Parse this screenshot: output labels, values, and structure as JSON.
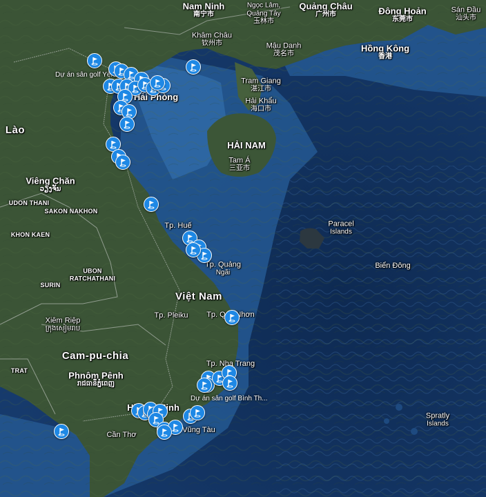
{
  "map": {
    "colors": {
      "sea_deep": "#112f5a",
      "sea_shelf": "#1e4a86",
      "land": "#3d5a3a",
      "island": "#2f3a3a"
    },
    "labels": [
      {
        "key": "nanning",
        "text": "Nam Ninh",
        "sub": "南宁市",
        "cls": "region"
      },
      {
        "key": "ngoclam",
        "text": "Ngọc Lâm,",
        "sub": "Quảng Tây",
        "cls": "small2"
      },
      {
        "key": "ngoclam2",
        "text": "",
        "sub": "玉林市",
        "cls": ""
      },
      {
        "key": "guangzhou",
        "text": "Quảng Châu",
        "sub": "广州市",
        "cls": "region"
      },
      {
        "key": "dongguan",
        "text": "Đông Hoản",
        "sub": "东莞市",
        "cls": "region"
      },
      {
        "key": "shantou",
        "text": "Sán Đầu",
        "sub": "汕头市",
        "cls": ""
      },
      {
        "key": "khamchau",
        "text": "Khâm Châu",
        "sub": "钦州市",
        "cls": ""
      },
      {
        "key": "maudanh",
        "text": "Mậu Danh",
        "sub": "茂名市",
        "cls": ""
      },
      {
        "key": "hongkong",
        "text": "Hồng Kông",
        "sub": "香港",
        "cls": "region"
      },
      {
        "key": "tramgiang",
        "text": "Tram Giang",
        "sub": "湛江市",
        "cls": ""
      },
      {
        "key": "haikhau",
        "text": "Hải Khẩu",
        "sub": "海口市",
        "cls": ""
      },
      {
        "key": "hainam",
        "text": "HẢI NAM",
        "sub": "",
        "cls": "region"
      },
      {
        "key": "tama",
        "text": "Tam Á",
        "sub": "三亚市",
        "cls": ""
      },
      {
        "key": "lao",
        "text": "Lào",
        "sub": "",
        "cls": "country"
      },
      {
        "key": "vientiane",
        "text": "Viêng Chăn",
        "sub": "ວຽງຈັນ",
        "cls": "region"
      },
      {
        "key": "udon",
        "text": "UDON THANI",
        "sub": "",
        "cls": "small"
      },
      {
        "key": "sakon",
        "text": "SAKON NAKHON",
        "sub": "",
        "cls": "small"
      },
      {
        "key": "khonkaen",
        "text": "KHON KAEN",
        "sub": "",
        "cls": "small"
      },
      {
        "key": "ubon",
        "text": "UBON",
        "sub": "RATCHATHANI",
        "cls": "small"
      },
      {
        "key": "surin",
        "text": "SURIN",
        "sub": "",
        "cls": "small"
      },
      {
        "key": "hue",
        "text": "Tp. Huế",
        "sub": "",
        "cls": ""
      },
      {
        "key": "quangngai",
        "text": "Tp. Quảng",
        "sub": "Ngãi",
        "cls": ""
      },
      {
        "key": "paracel",
        "text": "Paracel",
        "sub": "Islands",
        "cls": ""
      },
      {
        "key": "biendong",
        "text": "Biển Đông",
        "sub": "",
        "cls": ""
      },
      {
        "key": "vietnam",
        "text": "Việt Nam",
        "sub": "",
        "cls": "country"
      },
      {
        "key": "pleiku",
        "text": "Tp. Pleiku",
        "sub": "",
        "cls": ""
      },
      {
        "key": "quynhon",
        "text": "Tp. Quy Nhơn",
        "sub": "",
        "cls": ""
      },
      {
        "key": "siemreap",
        "text": "Xiêm Riệp",
        "sub": "ក្រុងសៀមរាប",
        "cls": ""
      },
      {
        "key": "cambodia",
        "text": "Cam-pu-chia",
        "sub": "",
        "cls": "country"
      },
      {
        "key": "nhatrang",
        "text": "Tp. Nha Trang",
        "sub": "",
        "cls": ""
      },
      {
        "key": "phnompenh",
        "text": "Phnôm Pênh",
        "sub": "រាជធានីភ្នំពេញ",
        "cls": "region"
      },
      {
        "key": "trat",
        "text": "TRAT",
        "sub": "",
        "cls": "small"
      },
      {
        "key": "hcm",
        "text": "Hồ Chí Minh",
        "sub": "",
        "cls": "region"
      },
      {
        "key": "cantho",
        "text": "Cần Thơ",
        "sub": "",
        "cls": ""
      },
      {
        "key": "vungtau",
        "text": "Vũng Tàu",
        "sub": "",
        "cls": ""
      },
      {
        "key": "spratly",
        "text": "Spratly",
        "sub": "Islands",
        "cls": ""
      },
      {
        "key": "haiphong",
        "text": "Hải Phòng",
        "sub": "",
        "cls": "region"
      }
    ],
    "markers": {
      "icon": "golf-flag-icon",
      "count_visible": 45,
      "labels": {
        "yenbai": "Dự án sân golf Yên Bái...",
        "binhthuan": "Dự án sân golf Bình Th..."
      }
    }
  }
}
